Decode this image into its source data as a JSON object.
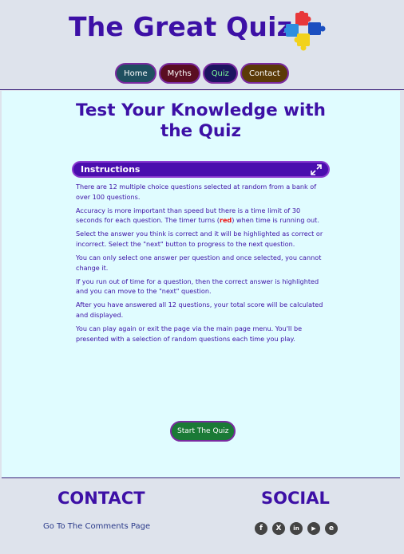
{
  "header": {
    "title": "The Great Quiz",
    "logo_icon": "puzzle-pieces-icon"
  },
  "nav": {
    "home": "Home",
    "myths": "Myths",
    "quiz": "Quiz",
    "contact": "Contact"
  },
  "main": {
    "heading_line1": "Test Your Knowledge with",
    "heading_line2": "the Quiz",
    "instructions": {
      "title": "Instructions",
      "expand_icon": "expand-arrows-icon",
      "p1": "There are 12 multiple choice questions selected at random from a bank of over 100 questions.",
      "p2_before": "Accuracy is more important than speed but there is a time limit of 30 seconds for each question. The timer turns (",
      "p2_red": "red",
      "p2_after": ") when time is running out.",
      "p3": "Select the answer you think is correct and it will be highlighted as correct or incorrect. Select the \"next\" button to progress to the next question.",
      "p4": "You can only select one answer per question and once selected, you cannot change it.",
      "p5": "If you run out of time for a question, then the correct answer is highlighted and you can move to the \"next\" question.",
      "p6": "After you have answered all 12 questions, your total score will be calculated and displayed.",
      "p7": "You can play again or exit the page via the main page menu. You'll be presented with a selection of random questions each time you play."
    },
    "start_button": "Start The Quiz"
  },
  "footer": {
    "contact_heading": "CONTACT",
    "social_heading": "SOCIAL",
    "comments_link": "Go To The Comments Page",
    "social_icons": [
      {
        "name": "facebook-icon",
        "glyph": "f"
      },
      {
        "name": "x-icon",
        "glyph": "X"
      },
      {
        "name": "linkedin-icon",
        "glyph": "in"
      },
      {
        "name": "youtube-icon",
        "glyph": "▶"
      },
      {
        "name": "edge-icon",
        "glyph": "e"
      }
    ]
  },
  "colors": {
    "primary_purple": "#3d10a6",
    "main_bg": "#e0fcff",
    "page_bg": "#dee3ec",
    "start_green": "#1a7a36"
  }
}
